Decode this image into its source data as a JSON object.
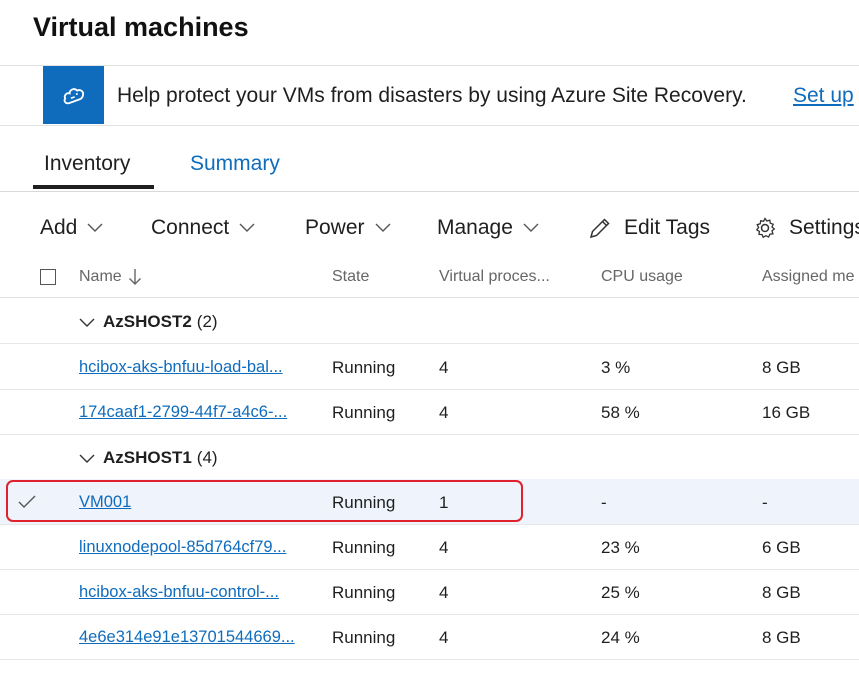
{
  "page_title": "Virtual machines",
  "banner": {
    "icon": "cloud-sync-icon",
    "text": "Help protect your VMs from disasters by using Azure Site Recovery.",
    "link": "Set up"
  },
  "tabs": [
    {
      "label": "Inventory",
      "active": true
    },
    {
      "label": "Summary",
      "active": false
    }
  ],
  "toolbar": {
    "add": "Add",
    "connect": "Connect",
    "power": "Power",
    "manage": "Manage",
    "edit_tags": "Edit Tags",
    "settings": "Settings"
  },
  "columns": {
    "name": "Name",
    "state": "State",
    "vprocs": "Virtual proces...",
    "cpu": "CPU usage",
    "memory": "Assigned me"
  },
  "groups": [
    {
      "name": "AzSHOST2",
      "count": "(2)",
      "rows": [
        {
          "name": "hcibox-aks-bnfuu-load-bal...",
          "state": "Running",
          "vprocs": "4",
          "cpu": "3 %",
          "memory": "8 GB",
          "selected": false
        },
        {
          "name": "174caaf1-2799-44f7-a4c6-...",
          "state": "Running",
          "vprocs": "4",
          "cpu": "58 %",
          "memory": "16 GB",
          "selected": false
        }
      ]
    },
    {
      "name": "AzSHOST1",
      "count": "(4)",
      "rows": [
        {
          "name": "VM001",
          "state": "Running",
          "vprocs": "1",
          "cpu": "-",
          "memory": "-",
          "selected": true
        },
        {
          "name": "linuxnodepool-85d764cf79...",
          "state": "Running",
          "vprocs": "4",
          "cpu": "23 %",
          "memory": "6 GB",
          "selected": false
        },
        {
          "name": "hcibox-aks-bnfuu-control-...",
          "state": "Running",
          "vprocs": "4",
          "cpu": "25 %",
          "memory": "8 GB",
          "selected": false
        },
        {
          "name": "4e6e314e91e13701544669...",
          "state": "Running",
          "vprocs": "4",
          "cpu": "24 %",
          "memory": "8 GB",
          "selected": false
        }
      ]
    }
  ],
  "colors": {
    "accent": "#0f6cbd",
    "highlight": "#e0202b",
    "selected_row": "#eff3fb"
  }
}
